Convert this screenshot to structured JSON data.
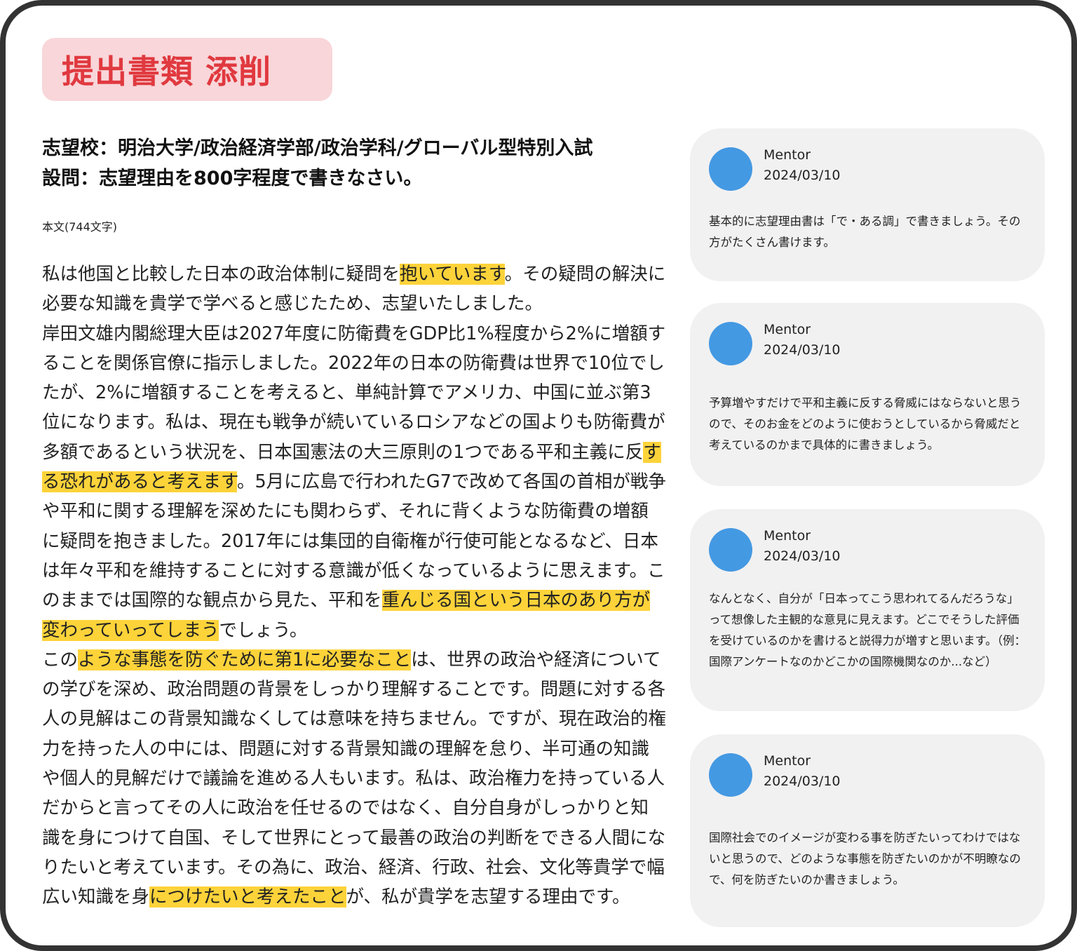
{
  "title": "提出書類 添削",
  "heading": {
    "line1": "志望校：明治大学/政治経済学部/政治学科/グローバル型特別入試",
    "line2": "設問：志望理由を800字程度で書きなさい。"
  },
  "char_count": "本文(744文字)",
  "essay": {
    "p1_a": "私は他国と比較した日本の政治体制に疑問を",
    "p1_hl": "抱いています",
    "p1_b": "。その疑問の解決に必要な知識を貴学で学べると感じたため、志望いたしました。",
    "p2_a": "岸田文雄内閣総理大臣は2027年度に防衛費をGDP比1%程度から2%に増額することを関係官僚に指示しました。2022年の日本の防衛費は世界で10位でしたが、2%に増額することを考えると、単純計算でアメリカ、中国に並ぶ第3位になります。私は、現在も戦争が続いているロシアなどの国よりも防衛費が多額であるという状況を、日本国憲法の大三原則の1つである平和主義に反",
    "p2_hl1": "する恐れがあると考えます",
    "p2_b": "。5月に広島で行われたG7で改めて各国の首相が戦争や平和に関する理解を深めたにも関わらず、それに背くような防衛費の増額に疑問を抱きました。2017年には集団的自衛権が行使可能となるなど、日本は年々平和を維持することに対する意識が低くなっているように思えます。このままでは国際的な観点から見た、平和を",
    "p2_hl2": "重んじる国という日本のあり方が変わっていってしまう",
    "p2_c": "でしょう。",
    "p3_a": "この",
    "p3_hl1": "ような事態を防ぐために第1に必要なこと",
    "p3_b": "は、世界の政治や経済についての学びを深め、政治問題の背景をしっかり理解することです。問題に対する各人の見解はこの背景知識なくしては意味を持ちません。ですが、現在政治的権力を持った人の中には、問題に対する背景知識の理解を怠り、半可通の知識や個人的見解だけで議論を進める人もいます。私は、政治権力を持っている人だからと言ってその人に政治を任せるのではなく、自分自身がしっかりと知識を身につけて自国、そして世界にとって最善の政治の判断をできる人間になりたいと考えています。その為に、政治、経済、行政、社会、文化等貴学で幅広い知識を身",
    "p3_hl2": "につけたいと考えたこと",
    "p3_c": "が、私が貴学を志望する理由です。"
  },
  "comments": [
    {
      "author": "Mentor",
      "date": "2024/03/10",
      "text": "基本的に志望理由書は「で・ある調」で書きましょう。その方がたくさん書けます。"
    },
    {
      "author": "Mentor",
      "date": "2024/03/10",
      "text": "予算増やすだけで平和主義に反する脅威にはならないと思うので、そのお金をどのように使おうとしているから脅威だと考えているのかまで具体的に書きましょう。"
    },
    {
      "author": "Mentor",
      "date": "2024/03/10",
      "text": "なんとなく、自分が「日本ってこう思われてるんだろうな」って想像した主観的な意見に見えます。どこでそうした評価を受けているのかを書けると説得力が増すと思います。（例：国際アンケートなのかどこかの国際機関なのか...など）"
    },
    {
      "author": "Mentor",
      "date": "2024/03/10",
      "text": "国際社会でのイメージが変わる事を防ぎたいってわけではないと思うので、どのような事態を防ぎたいのかが不明瞭なので、何を防ぎたいのか書きましょう。"
    }
  ],
  "colors": {
    "highlight": "#fdd33a",
    "title_text": "#e0393f",
    "title_bg": "#f8d6d9",
    "avatar": "#4499e3",
    "comment_bg": "#f1f1f1"
  }
}
